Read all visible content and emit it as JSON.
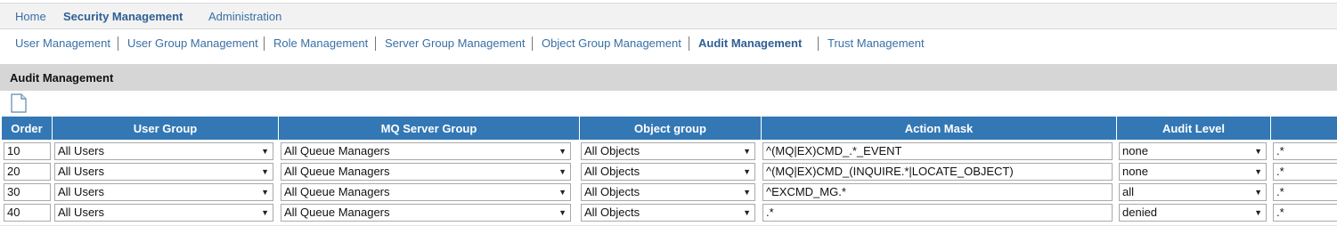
{
  "topnav": {
    "home": "Home",
    "security": "Security Management",
    "admin": "Administration"
  },
  "subnav": {
    "user_mgmt": "User Management",
    "user_group_mgmt": "User Group Management",
    "role_mgmt": "Role Management",
    "server_group_mgmt": "Server Group Management",
    "object_group_mgmt": "Object Group Management",
    "audit_mgmt": "Audit Management",
    "trust_mgmt": "Trust Management"
  },
  "panel": {
    "title": "Audit Management",
    "new_icon": "new-document-icon"
  },
  "table": {
    "headers": {
      "order": "Order",
      "user_group": "User Group",
      "mq_server_group": "MQ Server Group",
      "object_group": "Object group",
      "action_mask": "Action Mask",
      "audit_level": "Audit Level",
      "extra": ""
    },
    "rows": [
      {
        "order": "10",
        "user_group": "All Users",
        "mq_server_group": "All Queue Managers",
        "object_group": "All Objects",
        "action_mask": "^(MQ|EX)CMD_.*_EVENT",
        "audit_level": "none",
        "extra": ".*"
      },
      {
        "order": "20",
        "user_group": "All Users",
        "mq_server_group": "All Queue Managers",
        "object_group": "All Objects",
        "action_mask": "^(MQ|EX)CMD_(INQUIRE.*|LOCATE_OBJECT)",
        "audit_level": "none",
        "extra": ".*"
      },
      {
        "order": "30",
        "user_group": "All Users",
        "mq_server_group": "All Queue Managers",
        "object_group": "All Objects",
        "action_mask": "^EXCMD_MG.*",
        "audit_level": "all",
        "extra": ".*"
      },
      {
        "order": "40",
        "user_group": "All Users",
        "mq_server_group": "All Queue Managers",
        "object_group": "All Objects",
        "action_mask": ".*",
        "audit_level": "denied",
        "extra": ".*"
      }
    ]
  },
  "colors": {
    "header_bg": "#3378b5",
    "link": "#3a6fa5",
    "panel_bg": "#d6d6d6"
  }
}
